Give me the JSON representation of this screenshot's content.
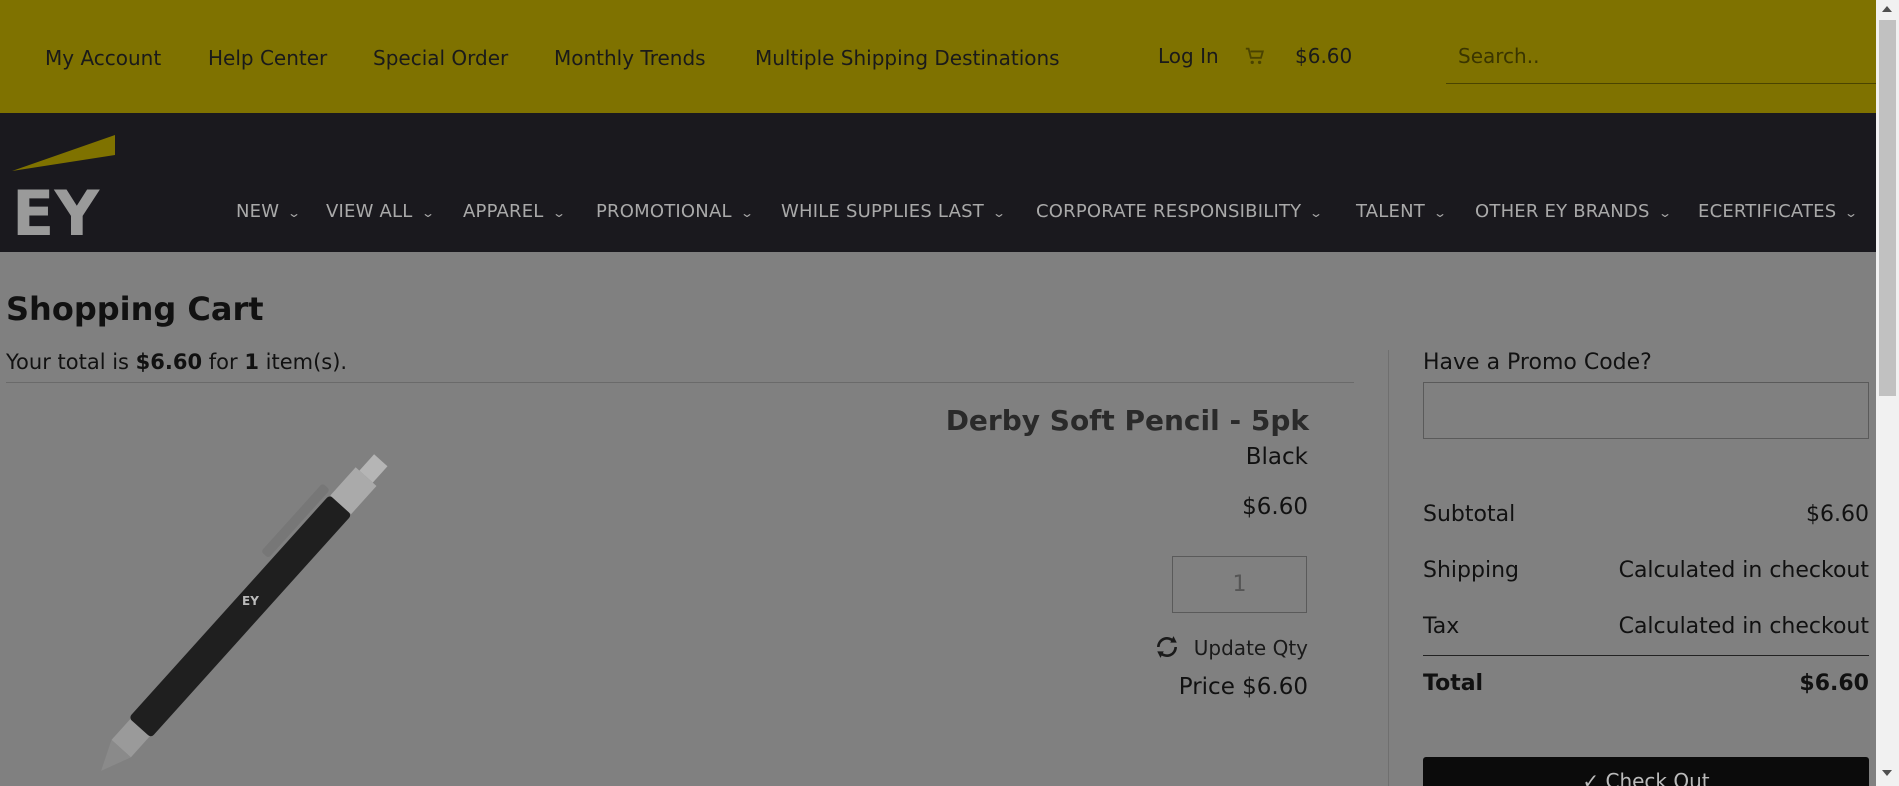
{
  "topbar": {
    "links": [
      "My Account",
      "Help Center",
      "Special Order",
      "Monthly Trends",
      "Multiple Shipping Destinations"
    ],
    "login": "Log In",
    "cart_total": "$6.60",
    "search_placeholder": "Search..",
    "background": "#7f7200"
  },
  "nav": {
    "logo_text": "EY",
    "items": [
      "NEW",
      "VIEW ALL",
      "APPAREL",
      "PROMOTIONAL",
      "WHILE SUPPLIES LAST",
      "CORPORATE RESPONSIBILITY",
      "TALENT",
      "OTHER EY BRANDS",
      "ECERTIFICATES"
    ],
    "chevron": "⌄",
    "background": "#1a191e"
  },
  "cart": {
    "title": "Shopping Cart",
    "summary_prefix": "Your total is ",
    "summary_total": "$6.60",
    "summary_mid": " for ",
    "summary_count": "1",
    "summary_suffix": " item(s).",
    "item": {
      "name": "Derby Soft Pencil - 5pk",
      "color": "Black",
      "price": "$6.60",
      "quantity": "1",
      "update_label": "Update Qty",
      "line_price": "Price $6.60"
    }
  },
  "order_summary": {
    "promo_label": "Have a Promo Code?",
    "subtotal_label": "Subtotal",
    "subtotal_value": "$6.60",
    "shipping_label": "Shipping",
    "shipping_value": "Calculated in checkout",
    "tax_label": "Tax",
    "tax_value": "Calculated in checkout",
    "total_label": "Total",
    "total_value": "$6.60",
    "checkout_label": "✓ Check Out"
  }
}
